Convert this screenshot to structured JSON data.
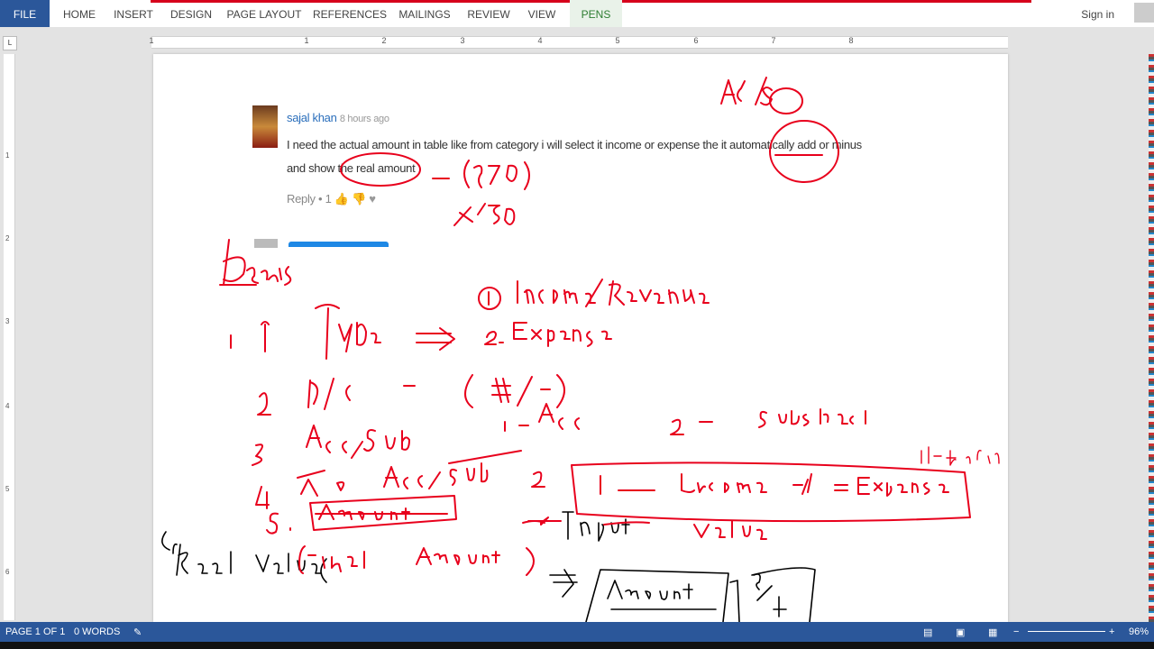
{
  "ribbon": {
    "tabs": [
      "FILE",
      "HOME",
      "INSERT",
      "DESIGN",
      "PAGE LAYOUT",
      "REFERENCES",
      "MAILINGS",
      "REVIEW",
      "VIEW",
      "PENS"
    ],
    "signin": "Sign in"
  },
  "ruler": {
    "corner": "L",
    "numbers": [
      "1",
      "1",
      "2",
      "3",
      "4",
      "5",
      "6",
      "7",
      "8"
    ],
    "vnumbers": [
      "1",
      "2",
      "3",
      "4",
      "5",
      "6"
    ]
  },
  "comment": {
    "author": "sajal khan",
    "time": "8 hours ago",
    "line1": "I need the actual amount in table like from category i will select it income or expense the it automatically add or minus",
    "line2": "and show the real amount",
    "reply": "Reply •",
    "likes": "1"
  },
  "status": {
    "page": "PAGE 1 OF 1",
    "words": "0 WORDS",
    "zoom": "96%"
  },
  "colors": {
    "accent": "#2b579a",
    "ink": "#e8001c"
  }
}
